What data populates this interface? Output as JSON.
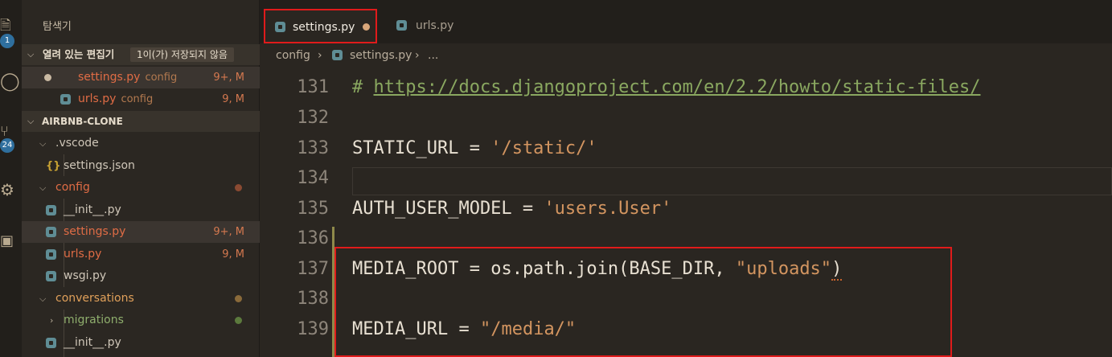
{
  "activity_bar": {
    "explorer_badge": "1",
    "scm_badge": "24",
    "icons": [
      "files-icon",
      "search-icon",
      "source-control-icon",
      "debug-icon",
      "extensions-icon"
    ]
  },
  "sidebar": {
    "title": "탐색기",
    "open_editors": {
      "label": "열려 있는 편집기",
      "unsaved": "1이(가) 저장되지 않음",
      "items": [
        {
          "name": "settings.py",
          "folder": "config",
          "status": "9+, M"
        },
        {
          "name": "urls.py",
          "folder": "config",
          "status": "9, M"
        }
      ]
    },
    "workspace": {
      "label": "AIRBNB-CLONE",
      "tree": [
        {
          "name": ".vscode"
        },
        {
          "name": "settings.json"
        },
        {
          "name": "config"
        },
        {
          "name": "__init__.py"
        },
        {
          "name": "settings.py",
          "status": "9+, M"
        },
        {
          "name": "urls.py",
          "status": "9, M"
        },
        {
          "name": "wsgi.py"
        },
        {
          "name": "conversations"
        },
        {
          "name": "migrations"
        },
        {
          "name": "__init__.py"
        }
      ]
    }
  },
  "tabs": [
    {
      "label": "settings.py",
      "active": true,
      "dirty": true
    },
    {
      "label": "urls.py",
      "active": false,
      "dirty": false
    }
  ],
  "breadcrumb": {
    "folder": "config",
    "file": "settings.py",
    "more": "..."
  },
  "editor": {
    "lines": [
      {
        "num": "131",
        "comment_hash": "# ",
        "url": "https://docs.djangoproject.com/en/2.2/howto/static-files/"
      },
      {
        "num": "132"
      },
      {
        "num": "133",
        "name": "STATIC_URL",
        "eq": " = ",
        "value": "'/static/'"
      },
      {
        "num": "134"
      },
      {
        "num": "135",
        "name": "AUTH_USER_MODEL",
        "eq": " = ",
        "value": "'users.User'"
      },
      {
        "num": "136"
      },
      {
        "num": "137",
        "name": "MEDIA_ROOT",
        "eq": " = ",
        "call": "os.path.join(BASE_DIR, ",
        "value": "\"uploads\"",
        "close": ")"
      },
      {
        "num": "138"
      },
      {
        "num": "139",
        "name": "MEDIA_URL",
        "eq": " = ",
        "value": "\"/media/\""
      }
    ]
  },
  "colors": {
    "background": "#2a2621",
    "modified": "#e06c45",
    "comment": "#8aa860",
    "string": "#d39560",
    "annotation_red": "#e01b1b"
  }
}
